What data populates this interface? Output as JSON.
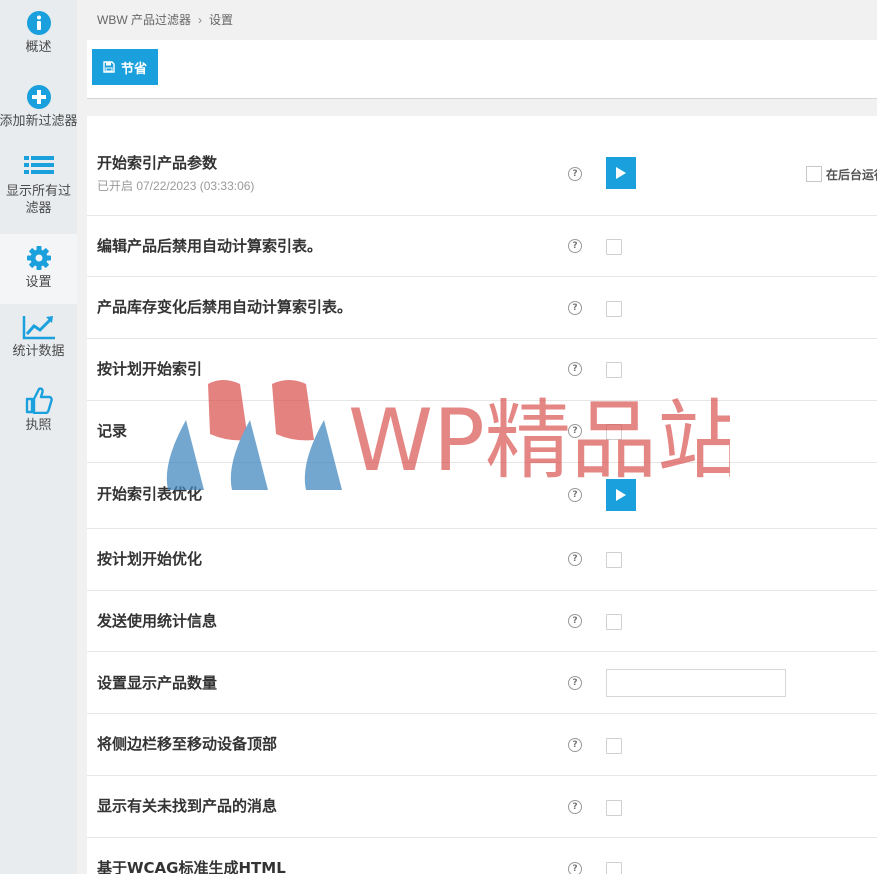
{
  "sidebar": {
    "items": [
      {
        "label": "概述",
        "icon": "info-circle-icon"
      },
      {
        "label": "添加新过滤器",
        "icon": "plus-circle-icon"
      },
      {
        "label": "显示所有过滤器",
        "icon": "list-icon"
      },
      {
        "label": "设置",
        "icon": "gear-icon",
        "active": true
      },
      {
        "label": "统计数据",
        "icon": "trend-chart-icon"
      },
      {
        "label": "执照",
        "icon": "thumbs-up-icon"
      }
    ]
  },
  "breadcrumb": {
    "plugin": "WBW 产品过滤器",
    "separator": "›",
    "current": "设置"
  },
  "toolbar": {
    "save_label": "节省"
  },
  "settings": {
    "index_start": {
      "label": "开始索引产品参数",
      "status": "已开启 07/22/2023 (03:33:06)",
      "background_label": "在后台运行"
    },
    "disable_autocalc_edit": {
      "label": "编辑产品后禁用自动计算索引表。"
    },
    "disable_autocalc_stock": {
      "label": "产品库存变化后禁用自动计算索引表。"
    },
    "scheduled_index": {
      "label": "按计划开始索引"
    },
    "logging": {
      "label": "记录"
    },
    "optimize_index": {
      "label": "开始索引表优化"
    },
    "scheduled_optimize": {
      "label": "按计划开始优化"
    },
    "send_stats": {
      "label": "发送使用统计信息"
    },
    "products_count": {
      "label": "设置显示产品数量",
      "value": ""
    },
    "move_sidebar_top": {
      "label": "将侧边栏移至移动设备顶部"
    },
    "not_found_message": {
      "label": "显示有关未找到产品的消息"
    },
    "wcag_html": {
      "label": "基于WCAG标准生成HTML"
    }
  },
  "help_mark": "?",
  "watermark": {
    "text": "WP精品站"
  },
  "colors": {
    "accent": "#1aa0dc",
    "sidebar_bg": "#e9ecef",
    "page_bg": "#f1f1f1",
    "watermark_red": "#d9534f",
    "watermark_blue": "#3f86bf"
  }
}
